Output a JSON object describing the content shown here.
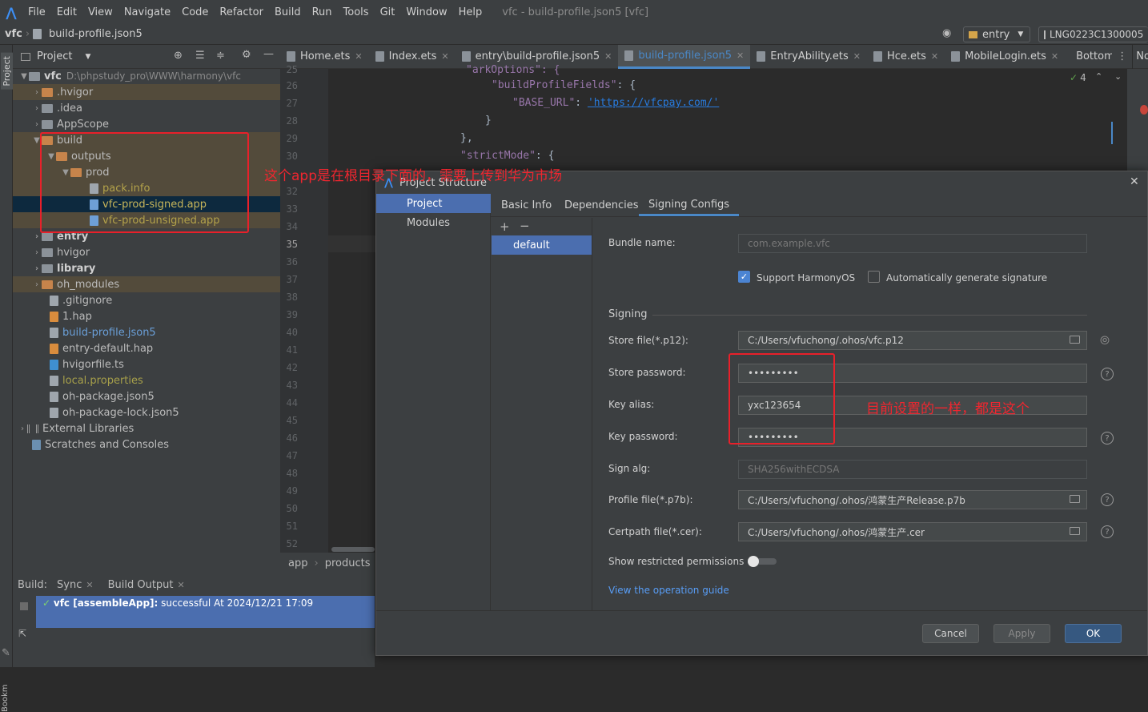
{
  "menu": {
    "items": [
      "File",
      "Edit",
      "View",
      "Navigate",
      "Code",
      "Refactor",
      "Build",
      "Run",
      "Tools",
      "Git",
      "Window",
      "Help"
    ],
    "window_title": "vfc - build-profile.json5 [vfc]"
  },
  "nav": {
    "project": "vfc",
    "file": "build-profile.json5",
    "run_config": "entry",
    "device": "LNG0223C1300005"
  },
  "left_stripe": {
    "project_label": "Project",
    "bookmarks_label": "Bookmarks"
  },
  "project_panel": {
    "title": "Project",
    "root_name": "vfc",
    "root_path": "D:\\phpstudy_pro\\WWW\\harmony\\vfc",
    "items": [
      {
        "label": ".hvigor"
      },
      {
        "label": ".idea"
      },
      {
        "label": "AppScope"
      },
      {
        "label": "build"
      },
      {
        "label": "outputs"
      },
      {
        "label": "prod"
      },
      {
        "label": "pack.info"
      },
      {
        "label": "vfc-prod-signed.app"
      },
      {
        "label": "vfc-prod-unsigned.app"
      },
      {
        "label": "entry"
      },
      {
        "label": "hvigor"
      },
      {
        "label": "library"
      },
      {
        "label": "oh_modules"
      },
      {
        "label": ".gitignore"
      },
      {
        "label": "1.hap"
      },
      {
        "label": "build-profile.json5"
      },
      {
        "label": "entry-default.hap"
      },
      {
        "label": "hvigorfile.ts"
      },
      {
        "label": "local.properties"
      },
      {
        "label": "oh-package.json5"
      },
      {
        "label": "oh-package-lock.json5"
      },
      {
        "label": "External Libraries"
      },
      {
        "label": "Scratches and Consoles"
      }
    ]
  },
  "editor": {
    "tabs": [
      "Home.ets",
      "Index.ets",
      "entry\\build-profile.json5",
      "build-profile.json5",
      "EntryAbility.ets",
      "Hce.ets",
      "MobileLogin.ets",
      "Bottom"
    ],
    "notification_tab": "Not",
    "inspection_count": "4",
    "line_numbers": [
      "25",
      "26",
      "27",
      "28",
      "29",
      "30",
      "32",
      "33",
      "34",
      "35",
      "36",
      "37",
      "38",
      "39",
      "40",
      "41",
      "42",
      "43",
      "44",
      "45",
      "46",
      "47",
      "48",
      "49",
      "50",
      "51",
      "52"
    ],
    "code": {
      "l25": "\"arkOptions\": {",
      "l26_key": "\"buildProfileFields\"",
      "l27_key": "\"BASE_URL\"",
      "l27_val": "'https://vfcpay.com/'",
      "l28": "}",
      "l29": "},",
      "l30_key": "\"strictMode\""
    },
    "breadcrumb": [
      "app",
      "products"
    ]
  },
  "build_panel": {
    "label": "Build:",
    "tabs": [
      "Sync",
      "Build Output"
    ],
    "result_name": "vfc [assembleApp]:",
    "result_text": "successful At 2024/12/21 17:09"
  },
  "dialog": {
    "title": "Project Structure",
    "nav": [
      "Project",
      "Modules"
    ],
    "tabs": [
      "Basic Info",
      "Dependencies",
      "Signing Configs"
    ],
    "config_list": [
      "default"
    ],
    "bundle_name_label": "Bundle name:",
    "bundle_name_placeholder": "com.example.vfc",
    "support_harmony": "Support HarmonyOS",
    "auto_sign": "Automatically generate signature",
    "signing_section": "Signing",
    "store_file_label": "Store file(*.p12):",
    "store_file": "C:/Users/vfuchong/.ohos/vfc.p12",
    "store_password_label": "Store password:",
    "store_password": "•••••••••",
    "key_alias_label": "Key alias:",
    "key_alias": "yxc123654",
    "key_password_label": "Key password:",
    "key_password": "•••••••••",
    "sign_alg_label": "Sign alg:",
    "sign_alg": "SHA256withECDSA",
    "profile_file_label": "Profile file(*.p7b):",
    "profile_file": "C:/Users/vfuchong/.ohos/鸿蒙生产Release.p7b",
    "certpath_label": "Certpath file(*.cer):",
    "certpath": "C:/Users/vfuchong/.ohos/鸿蒙生产.cer",
    "restricted_label": "Show restricted permissions",
    "guide_link": "View the operation guide",
    "cancel": "Cancel",
    "apply": "Apply",
    "ok": "OK"
  },
  "annotations": {
    "app_note": "这个app是在根目录下面的，需要上传到华为市场",
    "password_note": "目前设置的一样，都是这个"
  },
  "colors": {
    "accent": "#4b6eaf",
    "annotation_red": "#e8202a",
    "folder": "#c7844b"
  }
}
